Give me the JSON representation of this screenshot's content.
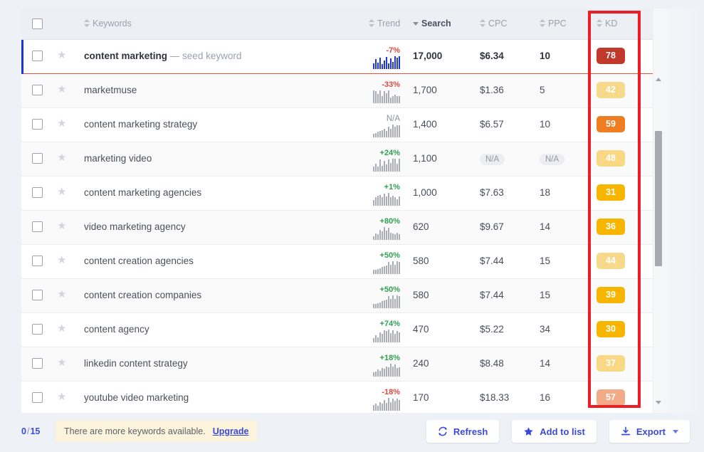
{
  "table": {
    "columns": [
      {
        "key": "checkbox",
        "label": "",
        "icon": "checkbox-icon"
      },
      {
        "key": "star",
        "label": ""
      },
      {
        "key": "keywords",
        "label": "Keywords",
        "sorted": false
      },
      {
        "key": "trend",
        "label": "Trend",
        "sorted": false
      },
      {
        "key": "search",
        "label": "Search",
        "sorted": true
      },
      {
        "key": "cpc",
        "label": "CPC",
        "sorted": false
      },
      {
        "key": "ppc",
        "label": "PPC",
        "sorted": false
      },
      {
        "key": "kd",
        "label": "KD",
        "sorted": false
      }
    ],
    "rows": [
      {
        "keyword": "content marketing",
        "seed_suffix": "— seed keyword",
        "is_seed": true,
        "trend": "-7%",
        "trend_dir": "down",
        "search": "17,000",
        "cpc": "$6.34",
        "ppc": "10",
        "kd": "78",
        "kd_color": "#c1392b",
        "spark": [
          7,
          12,
          8,
          14,
          6,
          11,
          15,
          7,
          13,
          9,
          16,
          14,
          16
        ]
      },
      {
        "keyword": "marketmuse",
        "is_seed": false,
        "trend": "-33%",
        "trend_dir": "down",
        "search": "1,700",
        "cpc": "$1.36",
        "ppc": "5",
        "kd": "42",
        "kd_color": "#f6d98a",
        "spark": [
          14,
          13,
          10,
          14,
          8,
          13,
          11,
          14,
          6,
          8,
          9,
          8,
          8
        ]
      },
      {
        "keyword": "content marketing strategy",
        "is_seed": false,
        "trend": "N/A",
        "trend_dir": "na",
        "search": "1,400",
        "cpc": "$6.57",
        "ppc": "10",
        "kd": "59",
        "kd_color": "#ef7d22",
        "spark": [
          4,
          5,
          6,
          7,
          8,
          9,
          7,
          12,
          9,
          14,
          12,
          13,
          13
        ]
      },
      {
        "keyword": "marketing video",
        "is_seed": false,
        "trend": "+24%",
        "trend_dir": "up",
        "search": "1,100",
        "cpc": "N/A",
        "ppc": "N/A",
        "kd": "48",
        "kd_color": "#f8d884",
        "spark": [
          5,
          8,
          5,
          12,
          6,
          11,
          7,
          12,
          9,
          13,
          13,
          8,
          13
        ]
      },
      {
        "keyword": "content marketing agencies",
        "is_seed": false,
        "trend": "+1%",
        "trend_dir": "up",
        "search": "1,000",
        "cpc": "$7.63",
        "ppc": "18",
        "kd": "31",
        "kd_color": "#f7b500",
        "spark": [
          6,
          9,
          11,
          12,
          9,
          13,
          10,
          14,
          9,
          11,
          9,
          7,
          10
        ]
      },
      {
        "keyword": "video marketing agency",
        "is_seed": false,
        "trend": "+80%",
        "trend_dir": "up",
        "search": "620",
        "cpc": "$9.67",
        "ppc": "14",
        "kd": "36",
        "kd_color": "#f7b500",
        "spark": [
          4,
          7,
          6,
          11,
          9,
          14,
          10,
          13,
          8,
          7,
          6,
          8,
          6
        ]
      },
      {
        "keyword": "content creation agencies",
        "is_seed": false,
        "trend": "+50%",
        "trend_dir": "up",
        "search": "580",
        "cpc": "$7.44",
        "ppc": "15",
        "kd": "44",
        "kd_color": "#f6d98a",
        "spark": [
          5,
          5,
          6,
          7,
          8,
          9,
          10,
          14,
          11,
          15,
          11,
          15,
          14
        ]
      },
      {
        "keyword": "content creation companies",
        "is_seed": false,
        "trend": "+50%",
        "trend_dir": "up",
        "search": "580",
        "cpc": "$7.44",
        "ppc": "15",
        "kd": "39",
        "kd_color": "#f7b500",
        "spark": [
          5,
          5,
          6,
          7,
          8,
          9,
          10,
          14,
          11,
          15,
          11,
          15,
          14
        ]
      },
      {
        "keyword": "content agency",
        "is_seed": false,
        "trend": "+74%",
        "trend_dir": "up",
        "search": "470",
        "cpc": "$5.22",
        "ppc": "34",
        "kd": "30",
        "kd_color": "#f7b500",
        "spark": [
          5,
          8,
          6,
          12,
          10,
          14,
          13,
          15,
          11,
          14,
          10,
          13,
          12
        ]
      },
      {
        "keyword": "linkedin content strategy",
        "is_seed": false,
        "trend": "+18%",
        "trend_dir": "up",
        "search": "240",
        "cpc": "$8.48",
        "ppc": "14",
        "kd": "37",
        "kd_color": "#f8d884",
        "spark": [
          5,
          6,
          8,
          7,
          10,
          9,
          12,
          11,
          15,
          12,
          14,
          10,
          11
        ]
      },
      {
        "keyword": "youtube video marketing",
        "is_seed": false,
        "trend": "-18%",
        "trend_dir": "down",
        "search": "170",
        "cpc": "$18.33",
        "ppc": "16",
        "kd": "57",
        "kd_color": "#f3ab87",
        "spark": [
          6,
          7,
          5,
          9,
          7,
          11,
          8,
          13,
          9,
          12,
          10,
          12,
          11
        ]
      }
    ]
  },
  "footer": {
    "counter_selected": "0",
    "counter_separator": "/",
    "counter_total": "15",
    "upsell_text": "There are more keywords available.",
    "upsell_link": "Upgrade",
    "buttons": [
      {
        "label": "Refresh",
        "icon": "refresh-icon"
      },
      {
        "label": "Add to list",
        "icon": "star-icon"
      },
      {
        "label": "Export",
        "icon": "download-icon",
        "has_chevron": true
      }
    ]
  },
  "annotation": {
    "color": "#ee1c25",
    "target_column": "KD"
  }
}
